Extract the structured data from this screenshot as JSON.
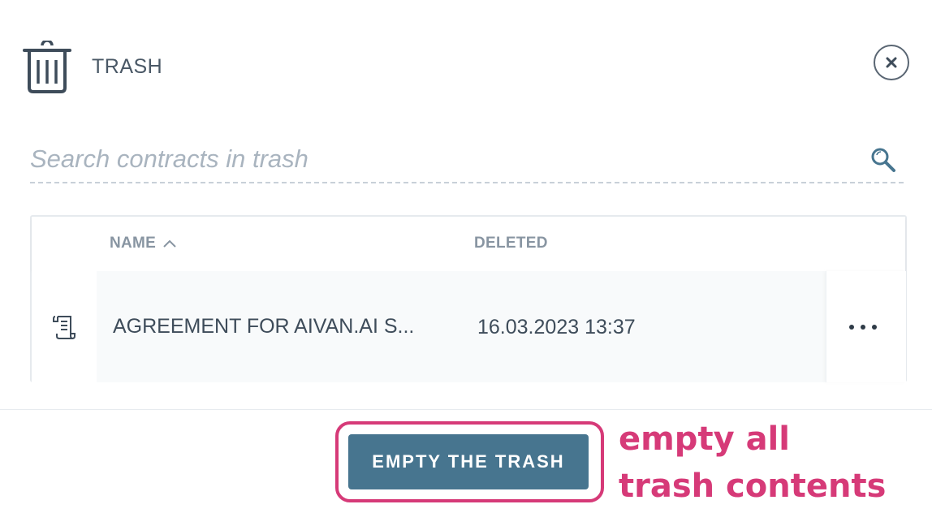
{
  "header": {
    "title": "TRASH",
    "trash_icon": "trash-icon",
    "close_icon": "close-icon"
  },
  "search": {
    "placeholder": "Search contracts in trash",
    "value": "",
    "icon": "search-icon"
  },
  "table": {
    "columns": [
      {
        "label": "NAME",
        "sort": "ascending",
        "sort_icon": "chevron-up-icon"
      },
      {
        "label": "DELETED"
      }
    ],
    "rows": [
      {
        "icon": "document-icon",
        "name": "AGREEMENT FOR AIVAN.AI S...",
        "deleted": "16.03.2023 13:37",
        "actions_icon": "more-options-icon"
      }
    ]
  },
  "footer": {
    "empty_button_label": "EMPTY THE TRASH"
  },
  "annotation": {
    "line1": "empty all",
    "line2": "trash contents"
  },
  "colors": {
    "accent": "#47758f",
    "annotation": "#d63a78",
    "text": "#3e4c5a",
    "muted": "#8895a2"
  }
}
